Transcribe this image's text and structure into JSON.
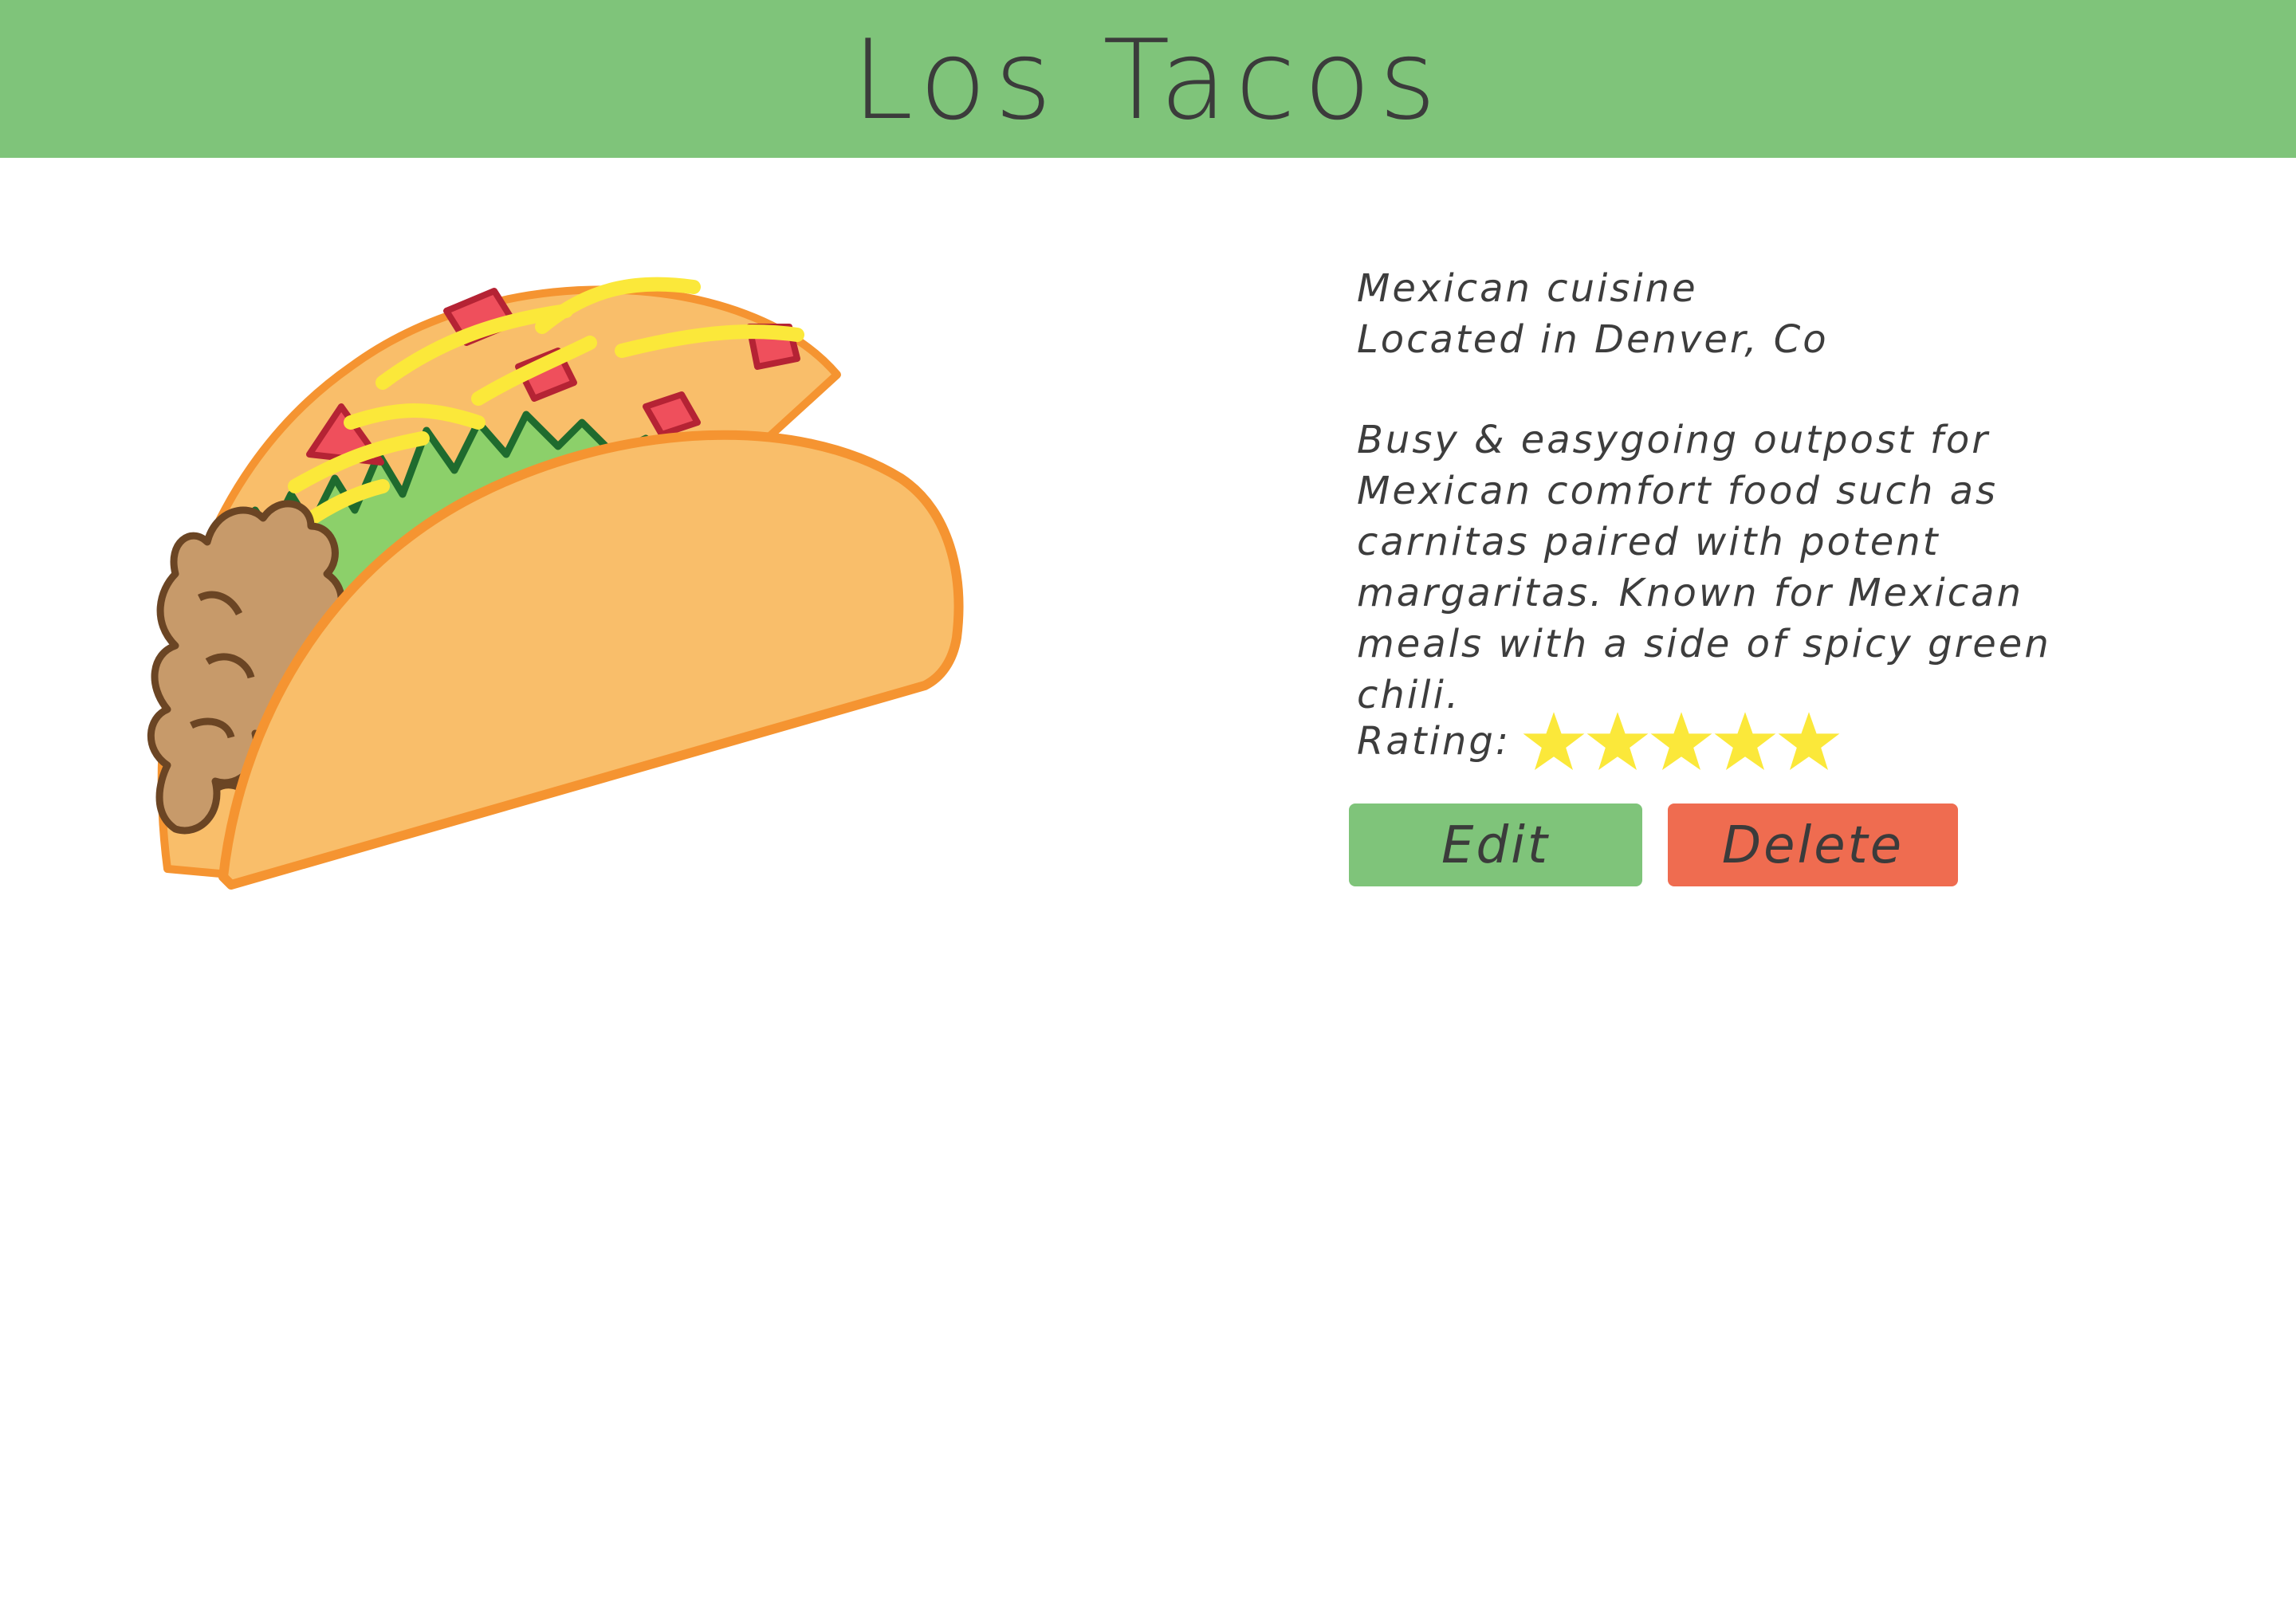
{
  "header": {
    "title": "Los Tacos"
  },
  "restaurant": {
    "cuisine": "Mexican cuisine",
    "location": "Located in Denver, Co",
    "description": "Busy & easygoing outpost for Mexican comfort food such as carnitas paired with potent margaritas. Known for Mexican meals with a side of spicy green chili.",
    "rating_label": "Rating:",
    "rating": 5,
    "rating_max": 5
  },
  "actions": {
    "edit_label": "Edit",
    "delete_label": "Delete"
  },
  "image": {
    "icon": "taco-icon"
  },
  "colors": {
    "header": "#7fc47a",
    "edit_button": "#7fc47a",
    "delete_button": "#ef6c50",
    "star": "#fbe83a",
    "taco_shell": "#f9be6a",
    "taco_outline": "#f59431"
  }
}
